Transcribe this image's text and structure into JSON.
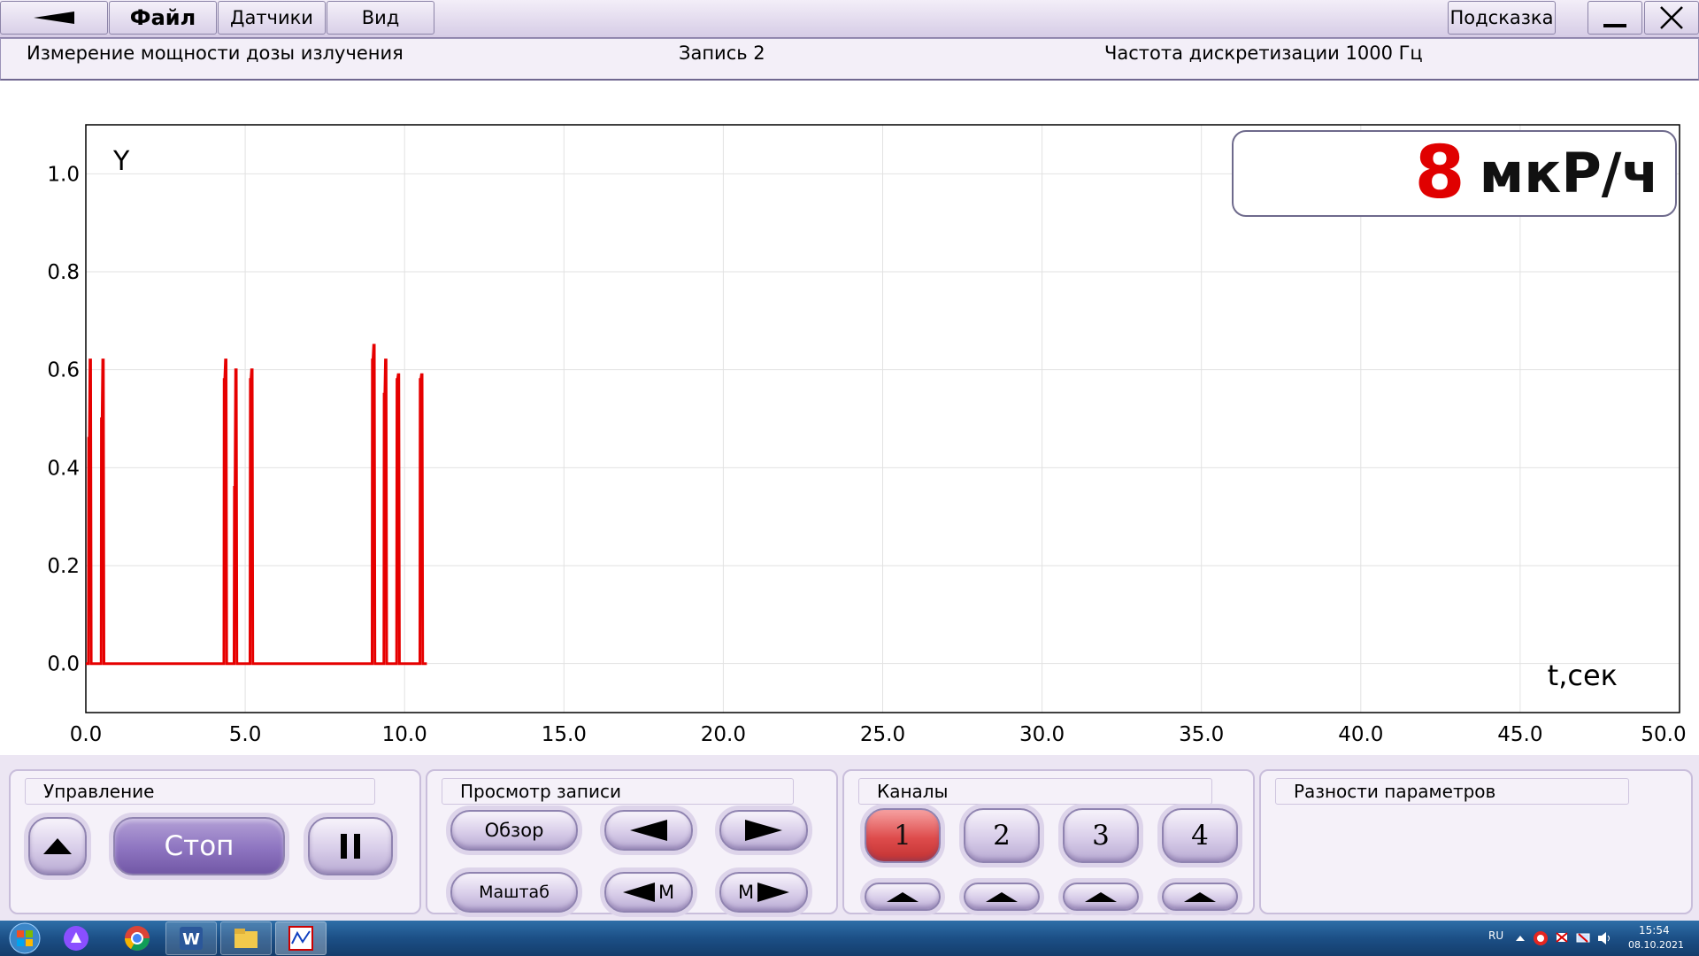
{
  "menu": {
    "back_icon": "arrow-left-icon",
    "file": "Файл",
    "sensors": "Датчики",
    "view": "Вид",
    "hint": "Подсказка",
    "minimize_icon": "minimize-icon",
    "close_icon": "close-icon"
  },
  "info": {
    "measurement": "Измерение мощности дозы излучения",
    "record": "Запись 2",
    "sampling": "Частота дискретизации 1000 Гц"
  },
  "reading": {
    "value": "8",
    "unit": "мкР/ч"
  },
  "chart_data": {
    "type": "line",
    "ylabel": "Y",
    "xlabel": "t,сек",
    "xlim": [
      0,
      50
    ],
    "ylim": [
      -0.1,
      1.1
    ],
    "xticks": [
      "0.0",
      "5.0",
      "10.0",
      "15.0",
      "20.0",
      "25.0",
      "30.0",
      "35.0",
      "40.0",
      "45.0",
      "50.0"
    ],
    "yticks": [
      "0.0",
      "0.2",
      "0.4",
      "0.6",
      "0.8",
      "1.0"
    ],
    "grid": true,
    "color": "#e60000",
    "series": [
      {
        "x": [
          0.0,
          0.05,
          0.08,
          0.09,
          0.11,
          0.13,
          0.15,
          0.17,
          0.45,
          0.48,
          0.49,
          0.51,
          0.53,
          0.55,
          0.57,
          4.3,
          4.33,
          4.34,
          4.36,
          4.38,
          4.4,
          4.42,
          4.62,
          4.65,
          4.66,
          4.68,
          4.7,
          4.72,
          4.74,
          5.12,
          5.15,
          5.16,
          5.18,
          5.2,
          5.22,
          5.24,
          8.95,
          8.98,
          8.99,
          9.01,
          9.03,
          9.05,
          9.07,
          9.32,
          9.35,
          9.36,
          9.38,
          9.4,
          9.42,
          9.44,
          9.72,
          9.75,
          9.76,
          9.78,
          9.8,
          9.82,
          9.84,
          10.45,
          10.48,
          10.49,
          10.51,
          10.53,
          10.55,
          10.57,
          10.7
        ],
        "y": [
          0,
          0,
          0,
          0.46,
          0.46,
          0.62,
          0.62,
          0,
          0,
          0,
          0.5,
          0.5,
          0.62,
          0.62,
          0,
          0,
          0,
          0.58,
          0.58,
          0.62,
          0.62,
          0,
          0,
          0,
          0.36,
          0.36,
          0.6,
          0.6,
          0,
          0,
          0,
          0.58,
          0.58,
          0.6,
          0.6,
          0,
          0,
          0,
          0.62,
          0.62,
          0.65,
          0.65,
          0,
          0,
          0,
          0.55,
          0.55,
          0.62,
          0.62,
          0,
          0,
          0,
          0.58,
          0.58,
          0.59,
          0.59,
          0,
          0,
          0,
          0.58,
          0.58,
          0.59,
          0.59,
          0,
          0
        ]
      }
    ]
  },
  "panels": {
    "control": {
      "title": "Управление",
      "up_icon": "arrow-up-icon",
      "stop": "Стоп",
      "pause_icon": "pause-icon"
    },
    "review": {
      "title": "Просмотр записи",
      "overview": "Обзор",
      "scale": "Маштаб",
      "m": "М",
      "left_icon": "arrow-left-icon",
      "right_icon": "arrow-right-icon"
    },
    "channels": {
      "title": "Каналы",
      "items": [
        "1",
        "2",
        "3",
        "4"
      ],
      "active": "1",
      "active_color": "#de4c4c"
    },
    "diff": {
      "title": "Разности параметров"
    }
  },
  "taskbar": {
    "lang": "RU",
    "time": "15:54",
    "date": "08.10.2021"
  }
}
